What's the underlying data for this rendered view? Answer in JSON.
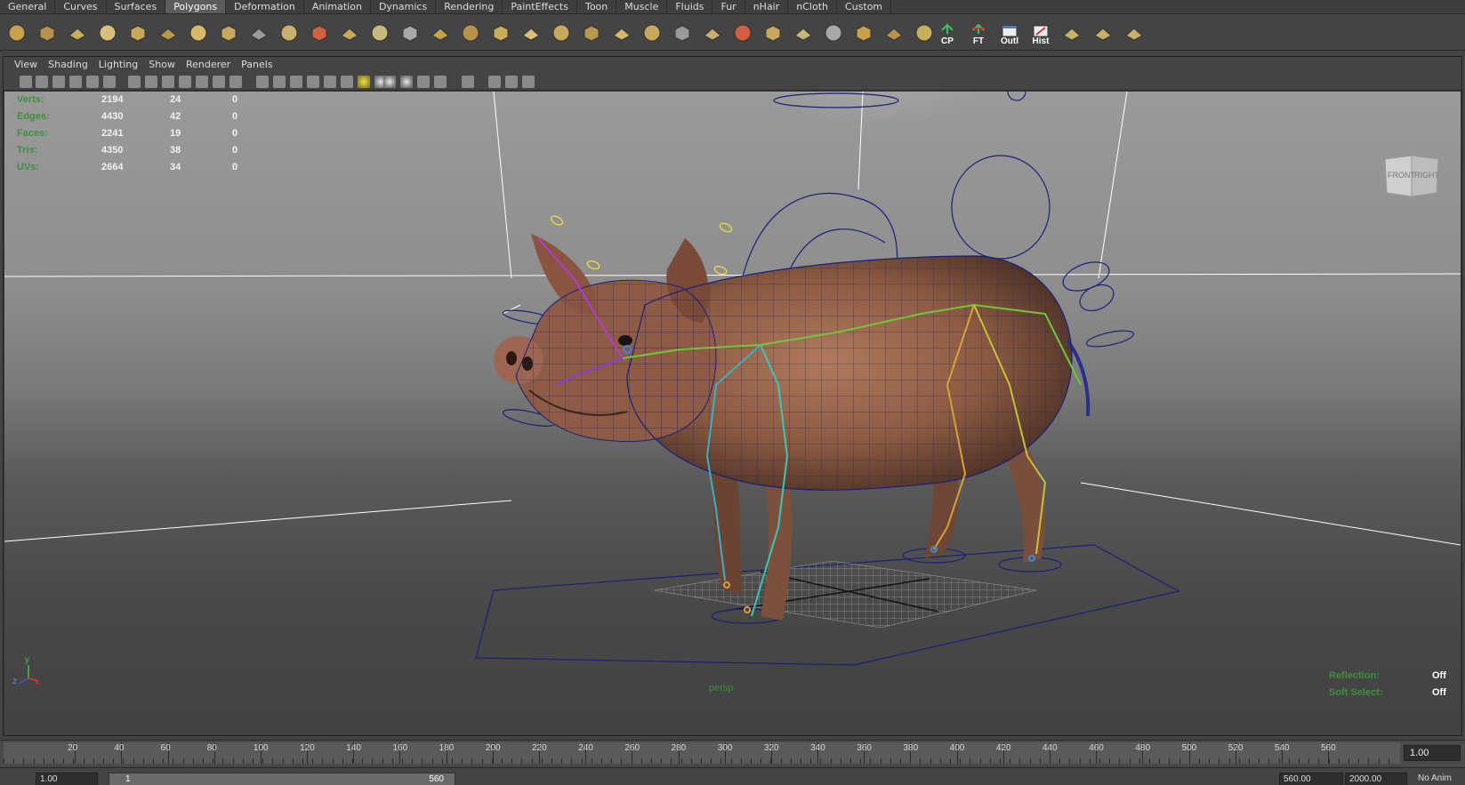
{
  "shelf_tabs": [
    {
      "label": "General",
      "active": false
    },
    {
      "label": "Curves",
      "active": false
    },
    {
      "label": "Surfaces",
      "active": false
    },
    {
      "label": "Polygons",
      "active": true
    },
    {
      "label": "Deformation",
      "active": false
    },
    {
      "label": "Animation",
      "active": false
    },
    {
      "label": "Dynamics",
      "active": false
    },
    {
      "label": "Rendering",
      "active": false
    },
    {
      "label": "PaintEffects",
      "active": false
    },
    {
      "label": "Toon",
      "active": false
    },
    {
      "label": "Muscle",
      "active": false
    },
    {
      "label": "Fluids",
      "active": false
    },
    {
      "label": "Fur",
      "active": false
    },
    {
      "label": "nHair",
      "active": false
    },
    {
      "label": "nCloth",
      "active": false
    },
    {
      "label": "Custom",
      "active": false
    }
  ],
  "shelf_buttons": {
    "cp": "CP",
    "ft": "FT",
    "outl": "Outl",
    "hist": "Hist"
  },
  "panel_menu": [
    "View",
    "Shading",
    "Lighting",
    "Show",
    "Renderer",
    "Panels"
  ],
  "hud": {
    "rows": [
      {
        "label": "Verts:",
        "v1": "2194",
        "v2": "24",
        "v3": "0"
      },
      {
        "label": "Edges:",
        "v1": "4430",
        "v2": "42",
        "v3": "0"
      },
      {
        "label": "Faces:",
        "v1": "2241",
        "v2": "19",
        "v3": "0"
      },
      {
        "label": "Tris:",
        "v1": "4350",
        "v2": "38",
        "v3": "0"
      },
      {
        "label": "UVs:",
        "v1": "2664",
        "v2": "34",
        "v3": "0"
      }
    ],
    "reflection_label": "Reflection:",
    "reflection_value": "Off",
    "soft_select_label": "Soft Select:",
    "soft_select_value": "Off",
    "camera": "persp"
  },
  "viewcube": {
    "front": "FRONT",
    "right": "RIGHT"
  },
  "axis": {
    "y": "y",
    "z": "z",
    "x": "x"
  },
  "timeslider": {
    "ticks": [
      "20",
      "40",
      "60",
      "80",
      "100",
      "120",
      "140",
      "160",
      "180",
      "200",
      "220",
      "240",
      "260",
      "280",
      "300",
      "320",
      "340",
      "360",
      "380",
      "400",
      "420",
      "440",
      "460",
      "480",
      "500",
      "520",
      "540",
      "560"
    ],
    "current_frame": "1.00"
  },
  "rangeslider": {
    "start_field": "1.00",
    "range_start": "1",
    "range_end": "560",
    "end_field": "560.00",
    "anim_end_field": "2000.00",
    "right_label": "No Anim"
  },
  "colors": {
    "hud_label": "#3f8f3f",
    "wire": "#1a1f7a",
    "active_tab": "#5c5c5c"
  }
}
